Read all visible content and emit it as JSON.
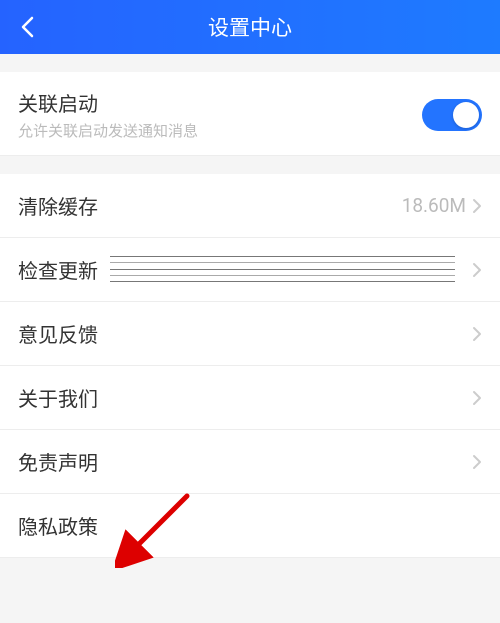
{
  "header": {
    "title": "设置中心"
  },
  "related": {
    "label": "关联启动",
    "sublabel": "允许关联启动发送通知消息"
  },
  "rows": {
    "clearCache": {
      "label": "清除缓存",
      "value": "18.60M"
    },
    "checkUpdate": {
      "label": "检查更新"
    },
    "feedback": {
      "label": "意见反馈"
    },
    "aboutUs": {
      "label": "关于我们"
    },
    "disclaimer": {
      "label": "免责声明"
    },
    "privacy": {
      "label": "隐私政策"
    }
  }
}
